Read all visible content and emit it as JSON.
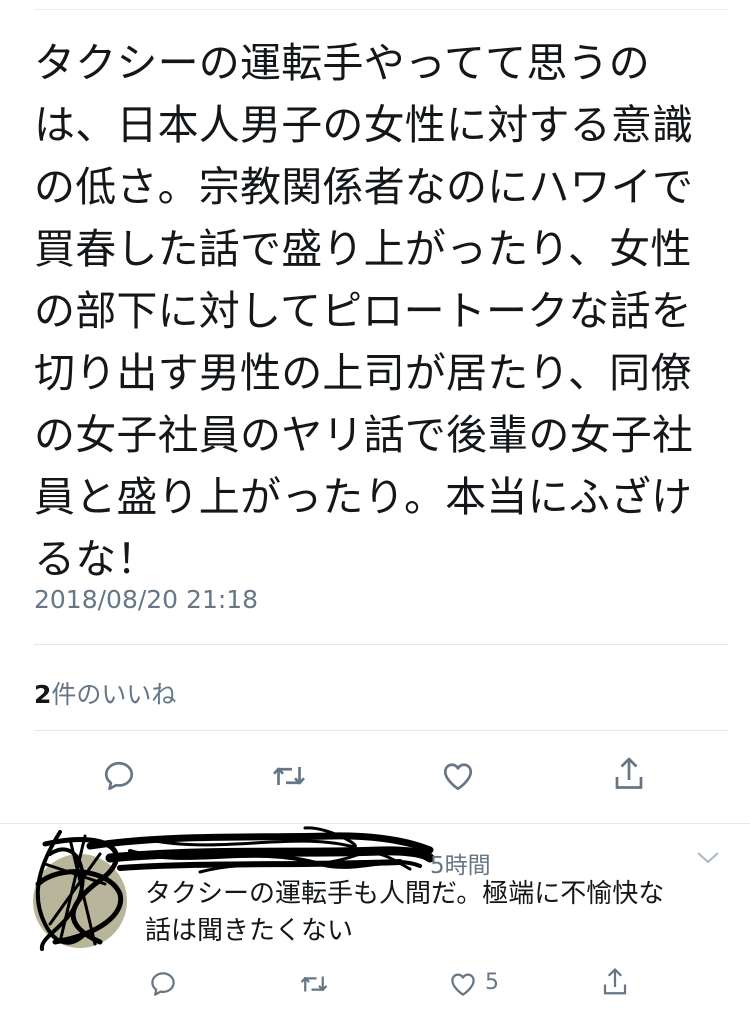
{
  "tweet": {
    "text": "タクシーの運転手やってて思うの\nは、日本人男子の女性に対する意識\nの低さ。宗教関係者なのにハワイで\n買春した話で盛り上がったり、女性\nの部下に対してピロートークな話を\n切り出す男性の上司が居たり、同僚\nの女子社員のヤリ話で後輩の女子社\n員と盛り上がったり。本当にふざけ\nるな！",
    "timestamp": "2018/08/20 21:18",
    "likes_count": "2",
    "likes_label": "件のいいね",
    "actions": [
      "reply-icon",
      "retweet-icon",
      "like-icon",
      "share-icon"
    ]
  },
  "reply": {
    "time": "5時間",
    "text": "タクシーの運転手も人間だ。極端に不愉快な\n話は聞きたくない",
    "like_count": "5",
    "actions": [
      "reply-icon",
      "retweet-icon",
      "like-icon",
      "share-icon"
    ]
  },
  "colors": {
    "text": "#14171a",
    "secondary": "#657786",
    "divider": "#e1e8ed"
  }
}
